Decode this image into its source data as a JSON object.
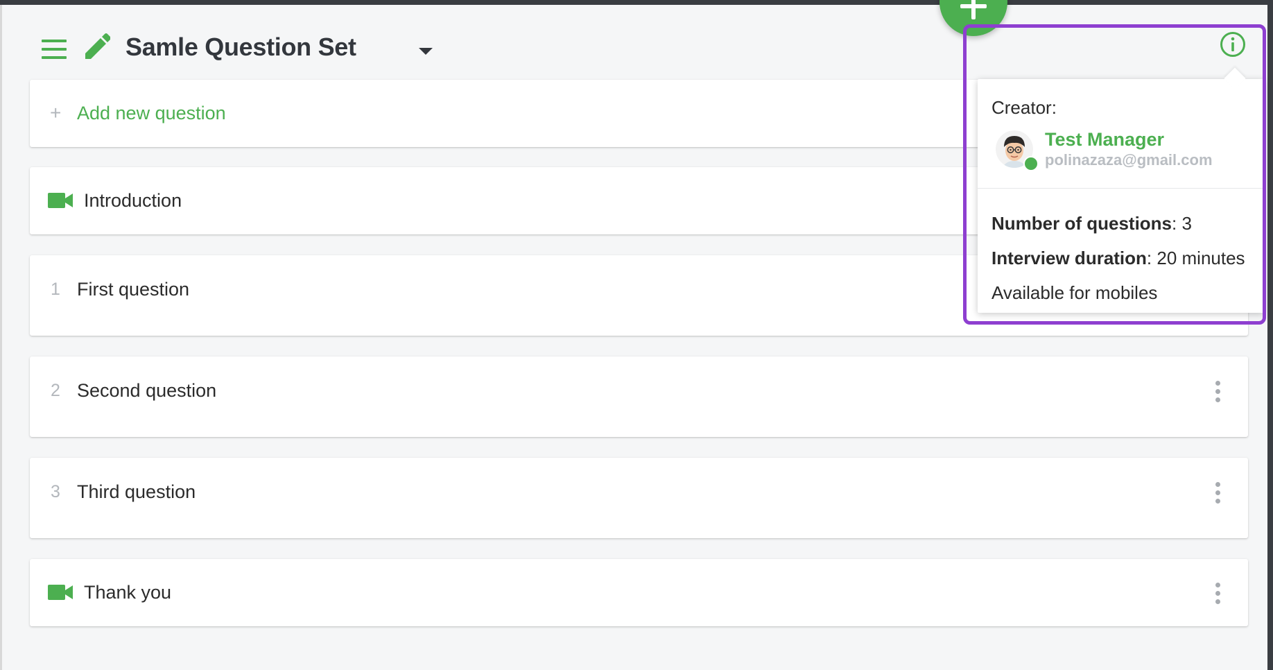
{
  "header": {
    "title": "Samle Question Set",
    "menu_icon": "hamburger-menu-icon",
    "edit_icon": "pencil-icon",
    "dropdown_icon": "caret-down-icon"
  },
  "fab": {
    "icon": "plus-icon"
  },
  "add_question": {
    "label": "Add new question",
    "prefix": "+"
  },
  "items": [
    {
      "type": "video",
      "number": "",
      "label": "Introduction",
      "icon": "video-camera-icon"
    },
    {
      "type": "question",
      "number": "1",
      "label": "First question"
    },
    {
      "type": "question",
      "number": "2",
      "label": "Second question"
    },
    {
      "type": "question",
      "number": "3",
      "label": "Third question"
    },
    {
      "type": "video",
      "number": "",
      "label": "Thank you",
      "icon": "video-camera-icon"
    }
  ],
  "info_popup": {
    "creator_label": "Creator:",
    "creator_name": "Test Manager",
    "creator_email": "polinazaza@gmail.com",
    "questions_label": "Number of questions",
    "questions_value": ": 3",
    "duration_label": "Interview duration",
    "duration_value": ": 20 minutes",
    "mobile_text": "Available for mobiles"
  },
  "colors": {
    "accent": "#4caf50",
    "highlight_outline": "#8e3fd0",
    "background": "#f5f6f7",
    "text": "#2b2b2b",
    "muted": "#b3b7bc"
  }
}
